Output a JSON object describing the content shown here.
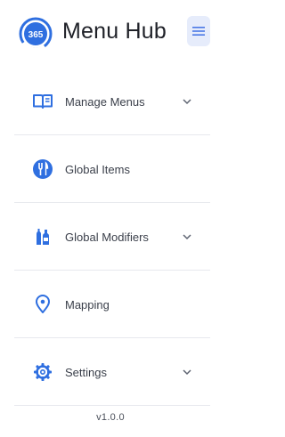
{
  "brand": {
    "logo_text": "365",
    "title": "Menu Hub",
    "accent": "#2f6fe0"
  },
  "nav": {
    "items": [
      {
        "label": "Manage Menus",
        "icon": "open-book-icon",
        "expandable": true
      },
      {
        "label": "Global Items",
        "icon": "fork-knife-icon",
        "expandable": false
      },
      {
        "label": "Global Modifiers",
        "icon": "bottles-icon",
        "expandable": true
      },
      {
        "label": "Mapping",
        "icon": "map-pin-icon",
        "expandable": false
      },
      {
        "label": "Settings",
        "icon": "gear-icon",
        "expandable": true
      }
    ]
  },
  "footer": {
    "version": "v1.0.0"
  }
}
